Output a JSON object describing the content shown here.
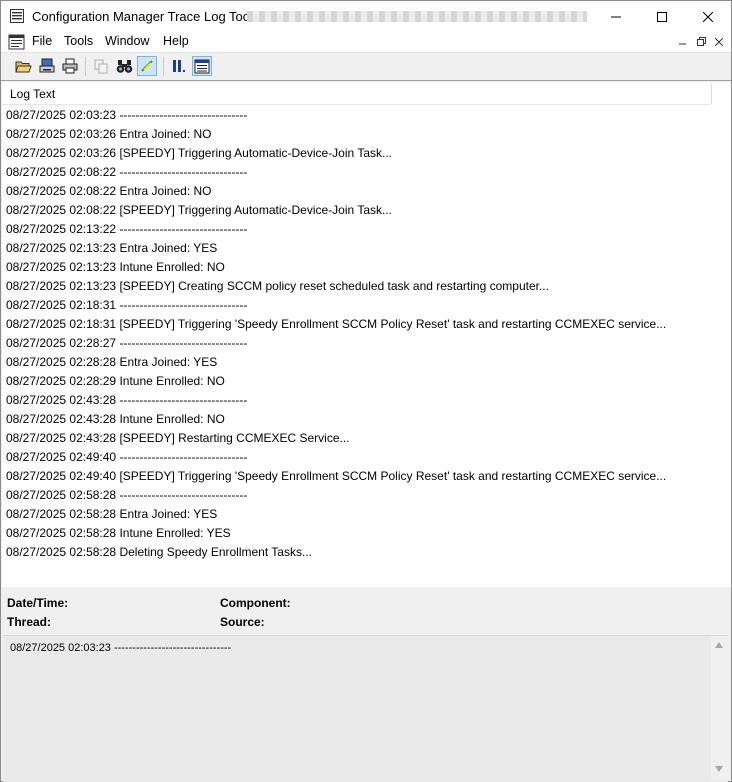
{
  "window": {
    "title": "Configuration Manager Trace Log Tool -"
  },
  "menu": {
    "file": "File",
    "tools": "Tools",
    "window": "Window",
    "help": "Help"
  },
  "toolbar": {
    "icons": [
      "open-folder-icon",
      "print-preview-icon",
      "print-icon",
      "copy-icon",
      "find-icon",
      "highlight-icon",
      "pause-icon",
      "filter-icon"
    ],
    "active": "highlight-icon"
  },
  "log": {
    "column_header": "Log Text",
    "rows": [
      "08/27/2025 02:03:23 --------------------------------",
      "08/27/2025 02:03:26 Entra Joined: NO",
      "08/27/2025 02:03:26 [SPEEDY] Triggering Automatic-Device-Join Task...",
      "08/27/2025 02:08:22 --------------------------------",
      "08/27/2025 02:08:22 Entra Joined: NO",
      "08/27/2025 02:08:22 [SPEEDY] Triggering Automatic-Device-Join Task...",
      "08/27/2025 02:13:22 --------------------------------",
      "08/27/2025 02:13:23 Entra Joined: YES",
      "08/27/2025 02:13:23 Intune Enrolled: NO",
      "08/27/2025 02:13:23 [SPEEDY] Creating SCCM policy reset scheduled task and restarting computer...",
      "08/27/2025 02:18:31 --------------------------------",
      "08/27/2025 02:18:31 [SPEEDY] Triggering 'Speedy Enrollment SCCM Policy Reset' task and restarting CCMEXEC service...",
      "08/27/2025 02:28:27 --------------------------------",
      "08/27/2025 02:28:28 Entra Joined: YES",
      "08/27/2025 02:28:29 Intune Enrolled: NO",
      "08/27/2025 02:43:28 --------------------------------",
      "08/27/2025 02:43:28 Intune Enrolled: NO",
      "08/27/2025 02:43:28 [SPEEDY] Restarting CCMEXEC Service...",
      "08/27/2025 02:49:40 --------------------------------",
      "08/27/2025 02:49:40 [SPEEDY] Triggering 'Speedy Enrollment SCCM Policy Reset' task and restarting CCMEXEC service...",
      "08/27/2025 02:58:28 --------------------------------",
      "08/27/2025 02:58:28 Entra Joined: YES",
      "08/27/2025 02:58:28 Intune Enrolled: YES",
      "08/27/2025 02:58:28 Deleting Speedy Enrollment Tasks..."
    ]
  },
  "details": {
    "datetime_label": "Date/Time:",
    "component_label": "Component:",
    "thread_label": "Thread:",
    "source_label": "Source:",
    "selected_text": "08/27/2025 02:03:23 --------------------------------"
  }
}
